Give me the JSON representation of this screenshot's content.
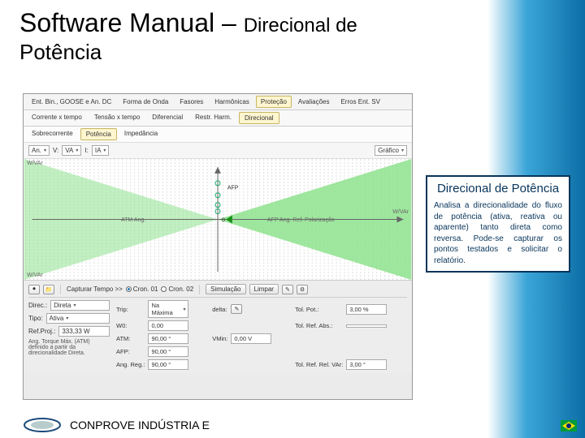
{
  "slide": {
    "title_main": "Software Manual – ",
    "title_sub": "Direcional de",
    "title_sub2": "Potência",
    "footer": "CONPROVE INDÚSTRIA E"
  },
  "callout": {
    "title": "Direcional de Potência",
    "body": "Analisa a direcionalidade do fluxo de potência (ativa, reativa ou aparente) tanto direta como reversa. Pode-se capturar os pontos testados e solicitar o relatório."
  },
  "tabs_top": [
    {
      "label": "Ent. Bin., GOOSE e An. DC",
      "active": false
    },
    {
      "label": "Forma de Onda",
      "active": false
    },
    {
      "label": "Fasores",
      "active": false
    },
    {
      "label": "Harmônicas",
      "active": false
    },
    {
      "label": "Proteção",
      "active": true
    },
    {
      "label": "Avaliações",
      "active": false
    },
    {
      "label": "Erros Ent. SV",
      "active": false
    }
  ],
  "tabs_mid": [
    {
      "label": "Corrente x tempo",
      "active": false
    },
    {
      "label": "Tensão x tempo",
      "active": false
    },
    {
      "label": "Diferencial",
      "active": false
    },
    {
      "label": "Restr. Harm.",
      "active": false
    },
    {
      "label": "Direcional",
      "active": true
    }
  ],
  "tabs_sub": [
    {
      "label": "Sobrecorrente",
      "active": false
    },
    {
      "label": "Potência",
      "active": true
    },
    {
      "label": "Impedância",
      "active": false
    }
  ],
  "ctrl": {
    "an_dd": "An.",
    "v_lbl": "V:",
    "v_val": "VA",
    "i_lbl": "I:",
    "i_val": "IA",
    "grafico": "Gráfico"
  },
  "chart": {
    "y_top": "W/VAr",
    "x_right": "W/VAr",
    "left_txt": "ATM Ang.",
    "right_txt": "AFP Ang. Ref. Polarização",
    "afp_label": "AFP",
    "origin": "0"
  },
  "cap_row": {
    "lbl": "Capturar Tempo >>",
    "opt1": "Cron. 01",
    "opt2": "Cron. 02",
    "sim": "Simulação",
    "limpar": "Limpar"
  },
  "colA": {
    "direc_lbl": "Direc.:",
    "direc_val": "Direta",
    "tipo_lbl": "Tipo:",
    "tipo_val": "Ativa",
    "ref_lbl": "Ref.Proj.:",
    "ref_val": "333,33 W",
    "atm_note": "Ang. Torque Máx. (ATM) definido a partir da direcionalidade Direta."
  },
  "grid": {
    "trip_lbl": "Trip:",
    "trip_val": "Na Máxima",
    "w0_lbl": "W0:",
    "w0_val": "0,00",
    "atm_lbl": "ATM:",
    "atm_val": "90,00 °",
    "afp_lbl": "AFP:",
    "afp_val": "90,00 °",
    "angreg_lbl": "Ang. Reg.:",
    "angreg_val": "90,00 °",
    "delta_lbl": "delta:",
    "delta_icon": "✎",
    "vmin_lbl": "VMin:",
    "vmin_val": "0,00 V",
    "tol_lbl": "Tol. Pot.:",
    "tol_val": "3,00 %",
    "tol2_lbl": "Tol. Ref. Abs.:",
    "tol3_lbl": "Tol. Ref. Rel. VAr:",
    "tol3_val": "3,00 °"
  },
  "icons": {
    "capture": "⏺",
    "pencil": "✎",
    "folder": "📁"
  }
}
